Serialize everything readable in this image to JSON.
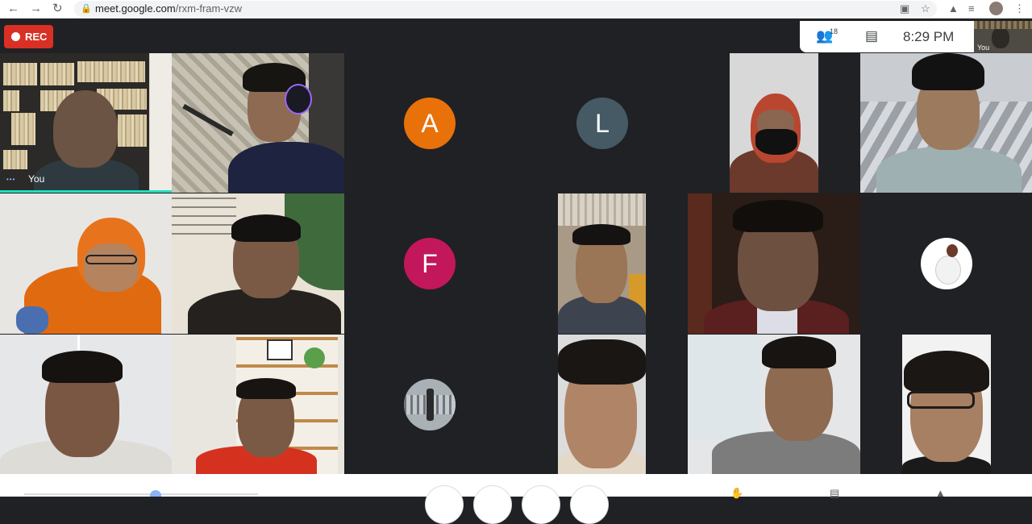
{
  "browser": {
    "url_host": "meet.google.com",
    "url_path": "/rxm-fram-vzw",
    "nav_icons": [
      "back-arrow-icon",
      "forward-arrow-icon",
      "reload-icon"
    ],
    "toolbar_icons": [
      "camera-icon",
      "star-icon",
      "puzzle-icon",
      "reading-list-icon",
      "more-vert-icon"
    ]
  },
  "meeting": {
    "rec_label": "REC",
    "participant_count": "18",
    "time": "8:29 PM",
    "self_label": "You"
  },
  "tiles": [
    {
      "kind": "video",
      "name": "You",
      "speaking": true
    },
    {
      "kind": "video"
    },
    {
      "kind": "avatar",
      "letter": "A",
      "color": "#e8710a"
    },
    {
      "kind": "avatar",
      "letter": "L",
      "color": "#455a64"
    },
    {
      "kind": "video"
    },
    {
      "kind": "video"
    },
    {
      "kind": "video"
    },
    {
      "kind": "video"
    },
    {
      "kind": "avatar",
      "letter": "F",
      "color": "#c2185b"
    },
    {
      "kind": "video"
    },
    {
      "kind": "video"
    },
    {
      "kind": "avatar-image"
    },
    {
      "kind": "video"
    },
    {
      "kind": "video"
    },
    {
      "kind": "avatar-image"
    },
    {
      "kind": "video"
    },
    {
      "kind": "video"
    },
    {
      "kind": "video"
    }
  ],
  "colors": {
    "background": "#202124",
    "rec": "#d93025",
    "speaking_bar": "#1fe0c0"
  }
}
